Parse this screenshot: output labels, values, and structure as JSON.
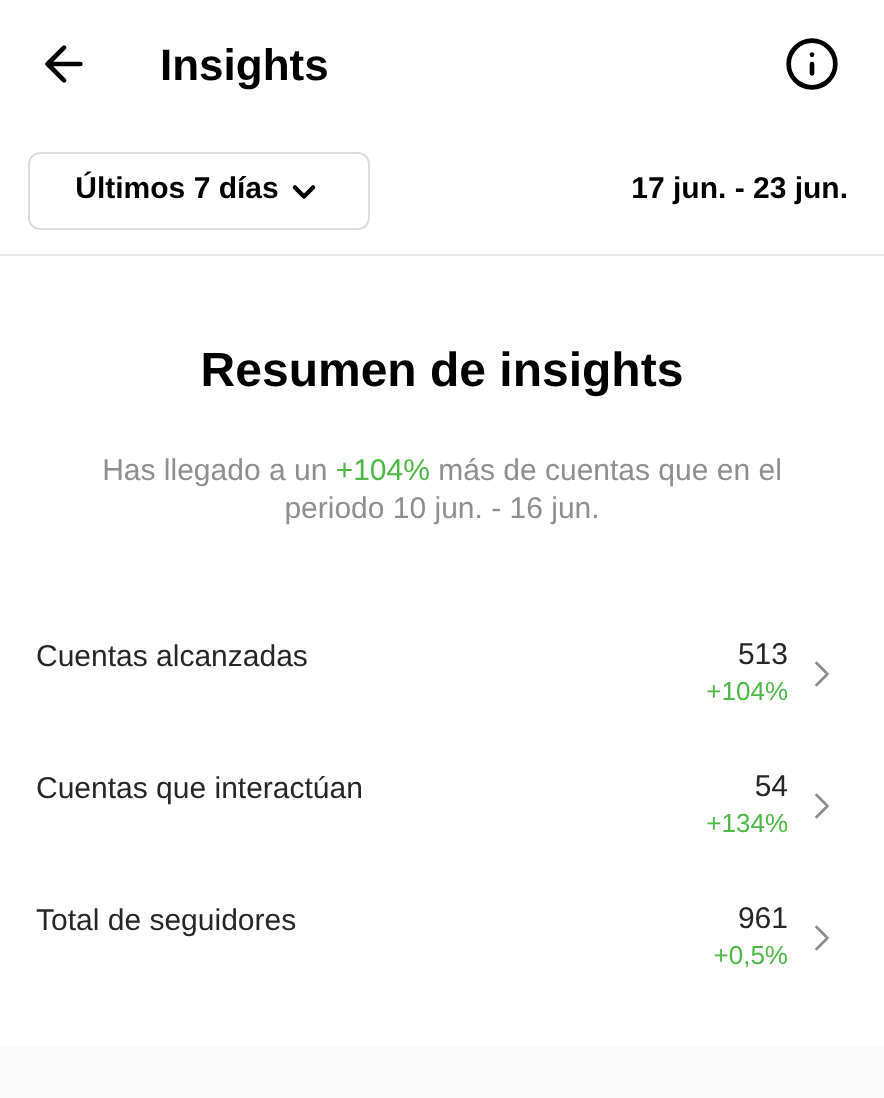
{
  "header": {
    "title": "Insights"
  },
  "period": {
    "dropdown": "Últimos 7 días",
    "range": "17 jun. - 23 jun."
  },
  "summary": {
    "title": "Resumen de insights",
    "text_before": "Has llegado a un ",
    "highlight": "+104%",
    "text_after": " más de cuentas que en el periodo 10 jun. - 16 jun."
  },
  "metrics": [
    {
      "label": "Cuentas alcanzadas",
      "value": "513",
      "change": "+104%"
    },
    {
      "label": "Cuentas que interactúan",
      "value": "54",
      "change": "+134%"
    },
    {
      "label": "Total de seguidores",
      "value": "961",
      "change": "+0,5%"
    }
  ]
}
